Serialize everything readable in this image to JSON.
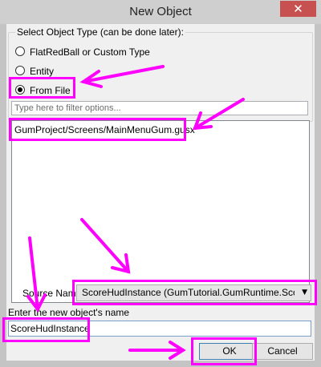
{
  "window": {
    "title": "New Object",
    "close_glyph": "✕"
  },
  "type_group": {
    "label": "Select Object Type (can be done later):",
    "options": [
      {
        "label": "FlatRedBall or Custom Type",
        "selected": false
      },
      {
        "label": "Entity",
        "selected": false
      },
      {
        "label": "From File",
        "selected": true
      }
    ]
  },
  "filter": {
    "placeholder": "Type here to filter options..."
  },
  "file_list": {
    "items": [
      "GumProject/Screens/MainMenuGum.gusx"
    ]
  },
  "source_name": {
    "label": "Source Name",
    "value": "ScoreHudInstance (GumTutorial.GumRuntime.ScoreHuc"
  },
  "object_name": {
    "label": "Enter the new object's name",
    "value": "ScoreHudInstance"
  },
  "buttons": {
    "ok": "OK",
    "cancel": "Cancel"
  },
  "colors": {
    "annotation": "#ff00ff",
    "close_button": "#c75050"
  }
}
